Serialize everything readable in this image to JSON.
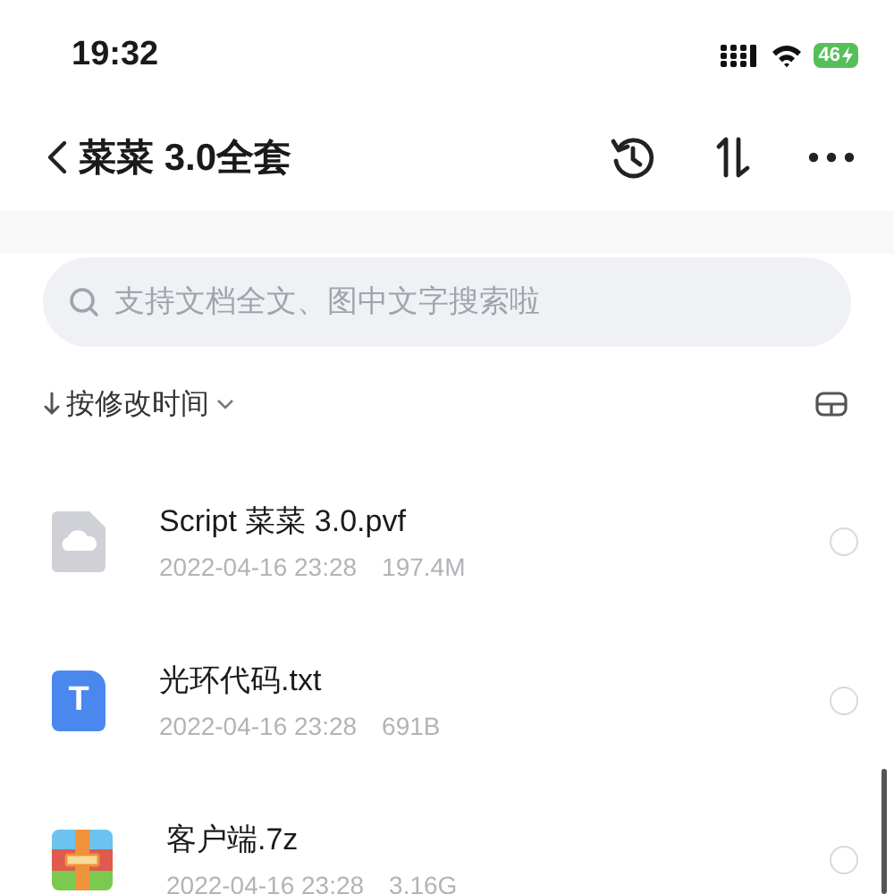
{
  "status_bar": {
    "time": "19:32",
    "battery": "46",
    "charging": true
  },
  "nav": {
    "title": "菜菜 3.0全套"
  },
  "search": {
    "placeholder": "支持文档全文、图中文字搜索啦"
  },
  "sort": {
    "label": "按修改时间"
  },
  "files": [
    {
      "name": "Script 菜菜 3.0.pvf",
      "date": "2022-04-16 23:28",
      "size": "197.4M",
      "kind": "cloud",
      "selected": false
    },
    {
      "name": "光环代码.txt",
      "date": "2022-04-16 23:28",
      "size": "691B",
      "kind": "text",
      "icon_letter": "T",
      "selected": false
    },
    {
      "name": "客户端.7z",
      "date": "2022-04-16 23:28",
      "size": "3.16G",
      "kind": "archive",
      "selected": false
    }
  ]
}
